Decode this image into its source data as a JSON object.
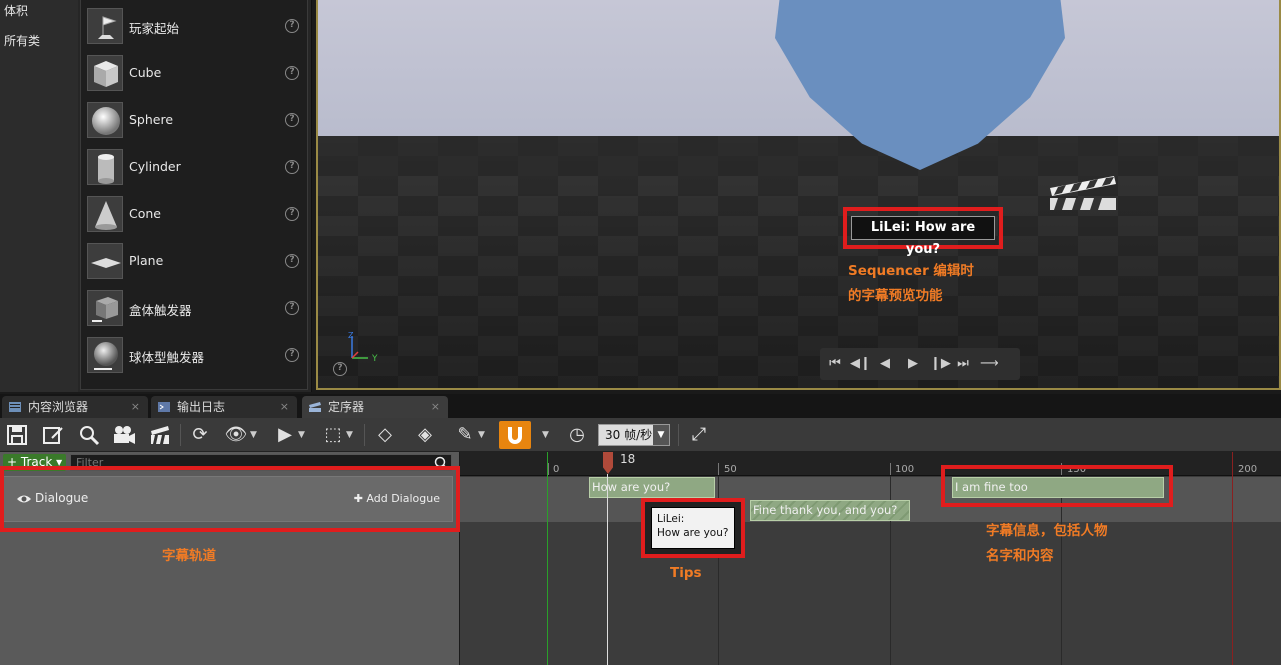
{
  "place_panel": {
    "categories": [
      "体积",
      "所有类"
    ],
    "assets": [
      {
        "label": "玩家起始",
        "icon": "player-start-icon"
      },
      {
        "label": "Cube",
        "icon": "cube-icon"
      },
      {
        "label": "Sphere",
        "icon": "sphere-icon"
      },
      {
        "label": "Cylinder",
        "icon": "cylinder-icon"
      },
      {
        "label": "Cone",
        "icon": "cone-icon"
      },
      {
        "label": "Plane",
        "icon": "plane-icon"
      },
      {
        "label": "盒体触发器",
        "icon": "box-trigger-icon"
      },
      {
        "label": "球体型触发器",
        "icon": "sphere-trigger-icon"
      }
    ],
    "help_glyph": "?"
  },
  "viewport": {
    "subtitle_preview": "LiLei: How are you?",
    "annotation_lines": [
      "Sequencer 编辑时",
      "的字幕预览功能"
    ],
    "axis_labels": {
      "z": "Z",
      "y": "Y"
    },
    "help_glyph": "?"
  },
  "tabs": [
    {
      "label": "内容浏览器",
      "icon": "content-browser-icon",
      "close": "×"
    },
    {
      "label": "输出日志",
      "icon": "output-log-icon",
      "close": "×"
    },
    {
      "label": "定序器",
      "icon": "sequencer-icon",
      "close": "×",
      "active": true
    }
  ],
  "toolbar": {
    "fps": "30 帧/秒",
    "accent_color": "#e8850f"
  },
  "sequencer": {
    "track_button": "Track",
    "filter_placeholder": "Filter",
    "track_name": "Dialogue",
    "add_label": "Add Dialogue",
    "track_annotation": "字幕轨道",
    "playhead_frame": "18",
    "ruler_ticks": [
      "0",
      "50",
      "100",
      "150",
      "200"
    ],
    "sections": [
      "How are you?",
      "Fine thank you, and you?",
      "I am fine too"
    ],
    "tip_lines": [
      "LiLei:",
      "How are you?"
    ],
    "tips_annotation": "Tips",
    "info_annotation_lines": [
      "字幕信息，包括人物",
      "名字和内容"
    ]
  }
}
